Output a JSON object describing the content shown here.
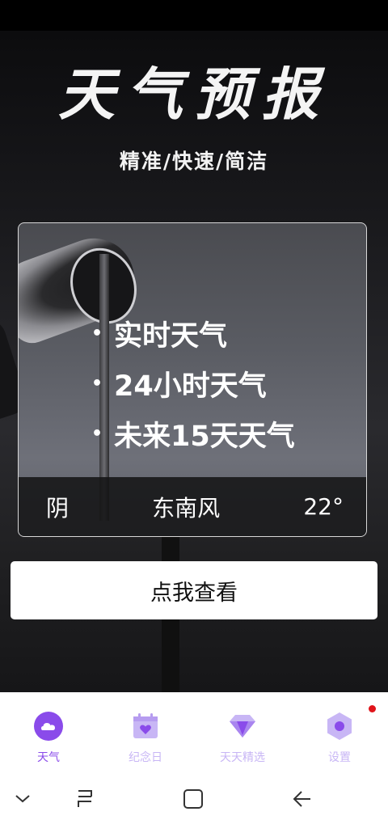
{
  "app": {
    "title": "天气预报",
    "subtitle": "精准/快速/简洁"
  },
  "card": {
    "features": [
      "实时天气",
      "24小时天气",
      "未来15天天气"
    ],
    "bullet": "•",
    "weather": "阴",
    "wind": "东南风",
    "temperature": "22°"
  },
  "cta": {
    "label": "点我查看"
  },
  "tabs": [
    {
      "label": "天气",
      "icon": "cloud-icon",
      "active": true
    },
    {
      "label": "纪念日",
      "icon": "calendar-heart-icon",
      "active": false
    },
    {
      "label": "天天精选",
      "icon": "diamond-icon",
      "active": false
    },
    {
      "label": "设置",
      "icon": "hexagon-settings-icon",
      "active": false
    }
  ],
  "colors": {
    "accent": "#8a4bea",
    "accent_light": "#c8b6f5",
    "badge": "#e0141a"
  },
  "nav": {
    "icons": [
      "chevron-down-icon",
      "recent-apps-icon",
      "home-icon",
      "back-icon"
    ]
  }
}
